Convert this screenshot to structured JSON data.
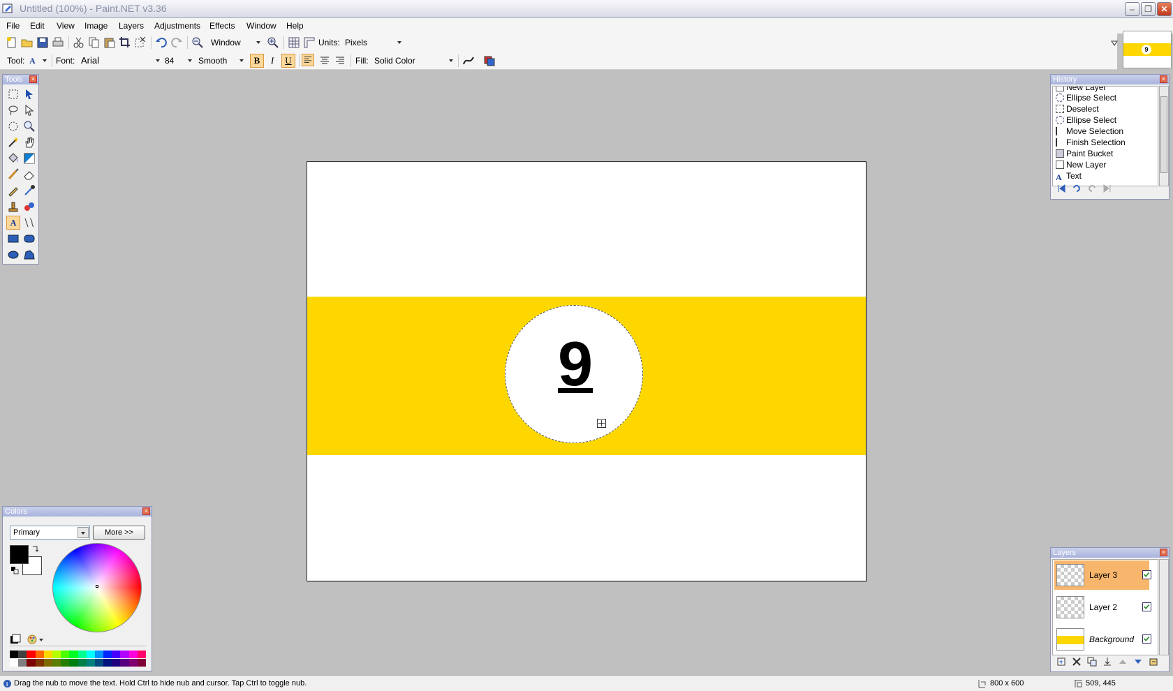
{
  "window": {
    "title": "Untitled (100%) - Paint.NET v3.36"
  },
  "menu": [
    "File",
    "Edit",
    "View",
    "Image",
    "Layers",
    "Adjustments",
    "Effects",
    "Window",
    "Help"
  ],
  "toolbar1": {
    "zoom_mode": "Window",
    "units_label": "Units:",
    "units_value": "Pixels"
  },
  "toolbar2": {
    "tool_label": "Tool:",
    "font_label": "Font:",
    "font_value": "Arial",
    "font_size": "84",
    "antialias": "Smooth",
    "bold": "B",
    "italic": "I",
    "underline": "U",
    "fill_label": "Fill:",
    "fill_value": "Solid Color"
  },
  "thumbnail_number": "9",
  "panels": {
    "tools_title": "Tools",
    "history_title": "History",
    "layers_title": "Layers",
    "colors_title": "Colors"
  },
  "history": [
    "New Layer",
    "Ellipse Select",
    "Deselect",
    "Ellipse Select",
    "Move Selection",
    "Finish Selection",
    "Paint Bucket",
    "New Layer",
    "Text"
  ],
  "layers": [
    {
      "name": "Layer 3",
      "selected": true
    },
    {
      "name": "Layer 2",
      "selected": false
    },
    {
      "name": "Background",
      "selected": false
    }
  ],
  "colors": {
    "mode": "Primary",
    "more_button": "More >>",
    "primary": "#000000",
    "secondary": "#ffffff"
  },
  "canvas": {
    "ball_number": "9",
    "band_color": "#fed700"
  },
  "status": {
    "message": "Drag the nub to move the text. Hold Ctrl to hide nub and cursor. Tap Ctrl to toggle nub.",
    "size": "800 x 600",
    "coords": "509, 445"
  }
}
